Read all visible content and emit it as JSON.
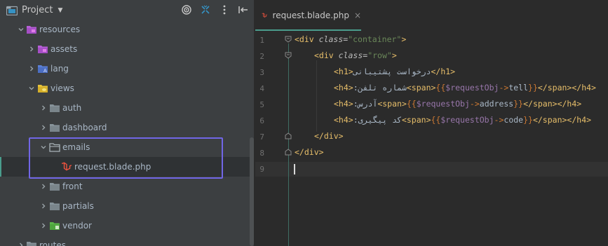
{
  "project_panel": {
    "title": "Project",
    "tree": [
      {
        "label": "resources",
        "icon": "folder-purple-icon",
        "expanded": true
      },
      {
        "label": "assets",
        "icon": "folder-purple-icon",
        "expanded": false
      },
      {
        "label": "lang",
        "icon": "folder-globe-icon",
        "expanded": false
      },
      {
        "label": "views",
        "icon": "folder-yellow-icon",
        "expanded": true
      },
      {
        "label": "auth",
        "icon": "folder-icon",
        "expanded": false
      },
      {
        "label": "dashboard",
        "icon": "folder-icon",
        "expanded": false
      },
      {
        "label": "emails",
        "icon": "folder-open-icon",
        "expanded": true
      },
      {
        "label": "request.blade.php",
        "icon": "laravel-blade-file-icon",
        "selected": true
      },
      {
        "label": "front",
        "icon": "folder-icon",
        "expanded": false
      },
      {
        "label": "partials",
        "icon": "folder-icon",
        "expanded": false
      },
      {
        "label": "vendor",
        "icon": "folder-green-icon",
        "expanded": false
      },
      {
        "label": "routes",
        "icon": "folder-icon",
        "expanded": false
      }
    ]
  },
  "editor": {
    "tab": {
      "label": "request.blade.php",
      "close": "×"
    },
    "line_numbers": [
      "1",
      "2",
      "3",
      "4",
      "5",
      "6",
      "7",
      "8",
      "9"
    ],
    "code": {
      "l1": {
        "open": "<div ",
        "attr": "class",
        "eq": "=",
        "val": "\"container\"",
        "close": ">"
      },
      "l2": {
        "open": "<div ",
        "attr": "class",
        "eq": "=",
        "val": "\"row\"",
        "close": ">"
      },
      "l3": {
        "open": "<h1>",
        "text": "درخواست پشتیبانی",
        "close": "</h1>"
      },
      "l4": {
        "open": "<h4>",
        "text": "شماره تلفن:",
        "span_open": "<span>",
        "b1": "{{",
        "var": "$requestObj",
        "arrow": "->",
        "prop": "tell",
        "b2": "}}",
        "span_close": "</span>",
        "close": "</h4>"
      },
      "l5": {
        "open": "<h4>",
        "text": "آدرس:",
        "span_open": "<span>",
        "b1": "{{",
        "var": "$requestObj",
        "arrow": "->",
        "prop": "address",
        "b2": "}}",
        "span_close": "</span>",
        "close": "</h4>"
      },
      "l6": {
        "open": "<h4>",
        "text": "کد پیگیری:",
        "span_open": "<span>",
        "b1": "{{",
        "var": "$requestObj",
        "arrow": "->",
        "prop": "code",
        "b2": "}}",
        "span_close": "</span>",
        "close": "</h4>"
      },
      "l7": {
        "close": "</div>"
      },
      "l8": {
        "close": "</div>"
      }
    }
  },
  "colors": {
    "accent": "#4a9c8c",
    "highlight_box": "#7166e6",
    "tag": "#e8bf6a",
    "string": "#6a8759",
    "variable": "#9876aa"
  }
}
